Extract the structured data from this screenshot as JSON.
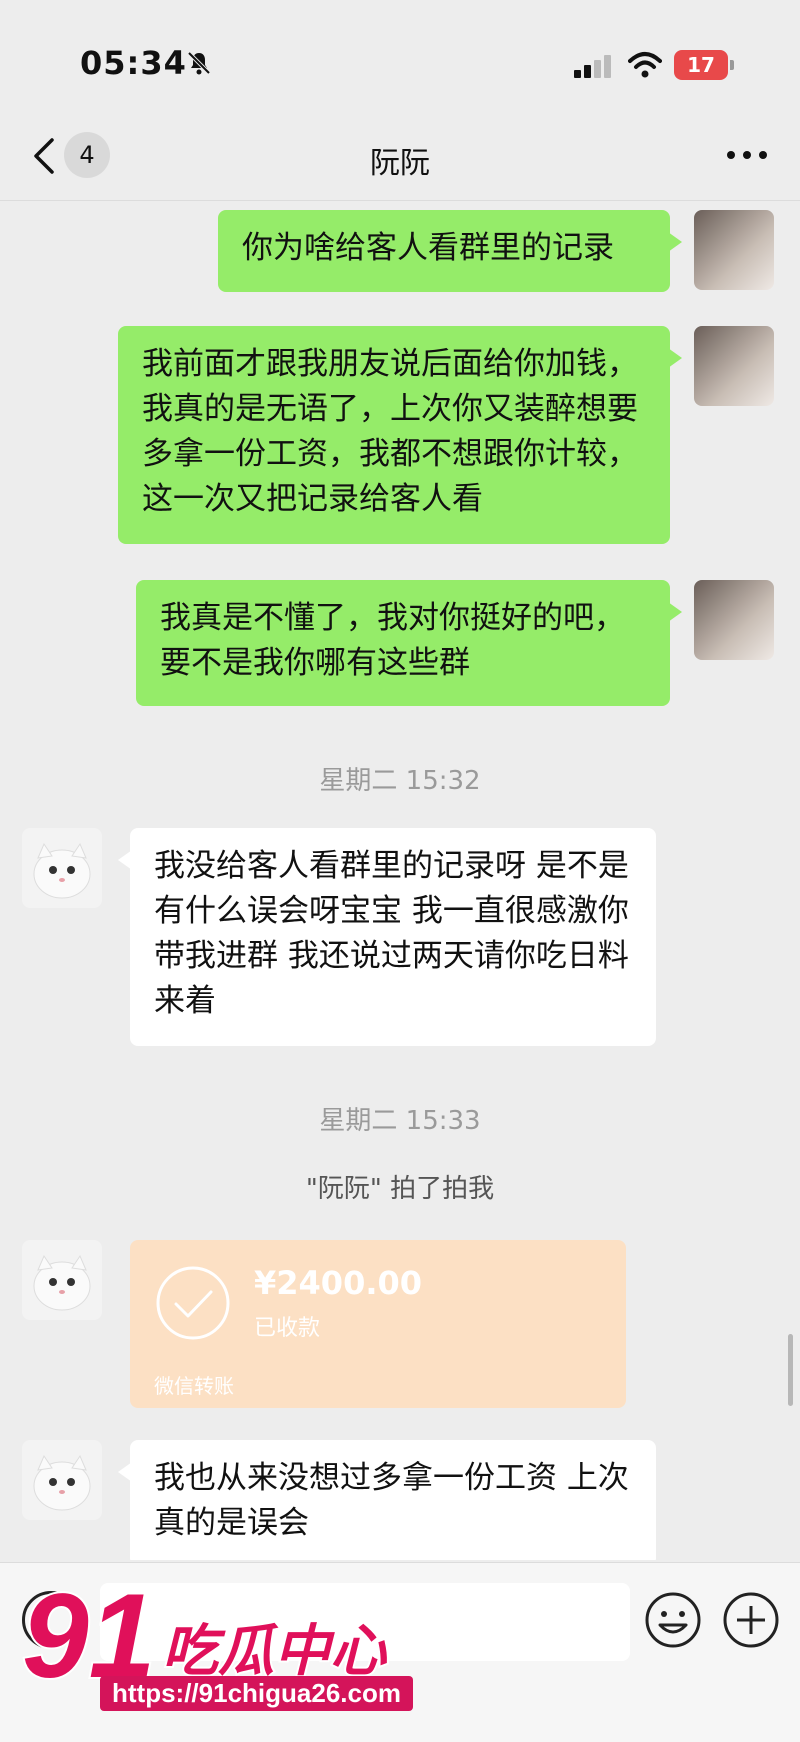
{
  "status_bar": {
    "time": "05:34",
    "battery": "17"
  },
  "nav": {
    "unread_count": "4",
    "title": "阮阮"
  },
  "messages": [
    {
      "text": "你为啥给客人看群里的记录"
    },
    {
      "text": "我前面才跟我朋友说后面给你加钱，我真的是无语了，上次你又装醉想要多拿一份工资，我都不想跟你计较，这一次又把记录给客人看"
    },
    {
      "text": "我真是不懂了，我对你挺好的吧，要不是我你哪有这些群"
    },
    {
      "text": "我没给客人看群里的记录呀 是不是有什么误会呀宝宝 我一直很感激你带我进群 我还说过两天请你吃日料来着"
    },
    {
      "text": "我也从来没想过多拿一份工资 上次真的是误会"
    }
  ],
  "timestamps": [
    "星期二 15:32",
    "星期二 15:33"
  ],
  "system_message": "\"阮阮\" 拍了拍我",
  "transfer": {
    "amount": "¥2400.00",
    "status": "已收款",
    "footer": "微信转账"
  },
  "watermark": {
    "logo_number": "91",
    "logo_text": "吃瓜中心",
    "url": "https://91chigua26.com"
  }
}
